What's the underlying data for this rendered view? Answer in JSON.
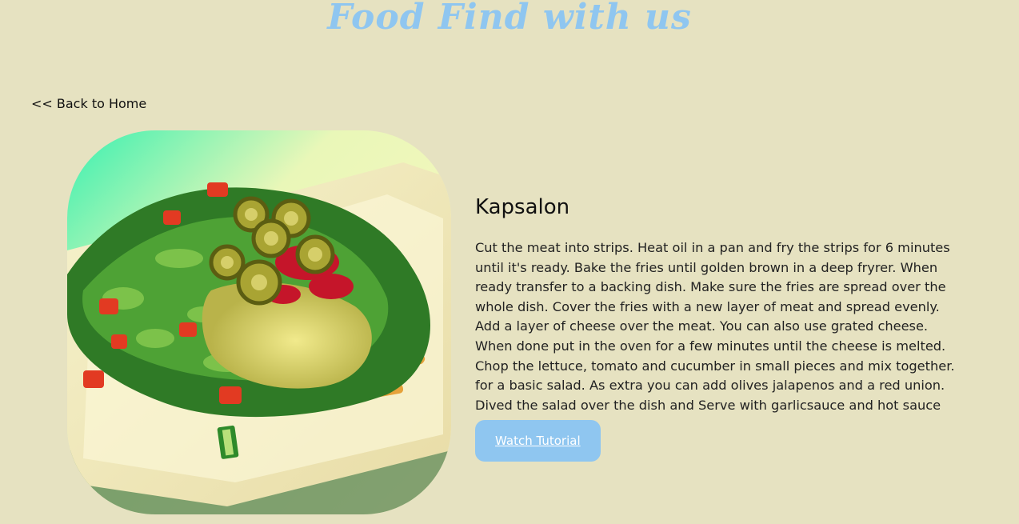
{
  "header": {
    "title": "Food Find with us"
  },
  "nav": {
    "back_label": "<< Back to Home"
  },
  "recipe": {
    "image_name": "kapsalon-photo",
    "title": "Kapsalon",
    "description": "Cut the meat into strips. Heat oil in a pan and fry the strips for 6 minutes until it's ready. Bake the fries until golden brown in a deep fryrer. When ready transfer to a backing dish. Make sure the fries are spread over the whole dish. Cover the fries with a new layer of meat and spread evenly. Add a layer of cheese over the meat. You can also use grated cheese. When done put in the oven for a few minutes until the cheese is melted. Chop the lettuce, tomato and cucumber in small pieces and mix together. for a basic salad. As extra you can add olives jalapenos and a red union. Dived the salad over the dish and Serve with garlicsauce and hot sauce",
    "button_label": "Watch Tutorial"
  },
  "colors": {
    "background": "#e6e2c1",
    "accent": "#8fc6f0",
    "text": "#111111"
  }
}
